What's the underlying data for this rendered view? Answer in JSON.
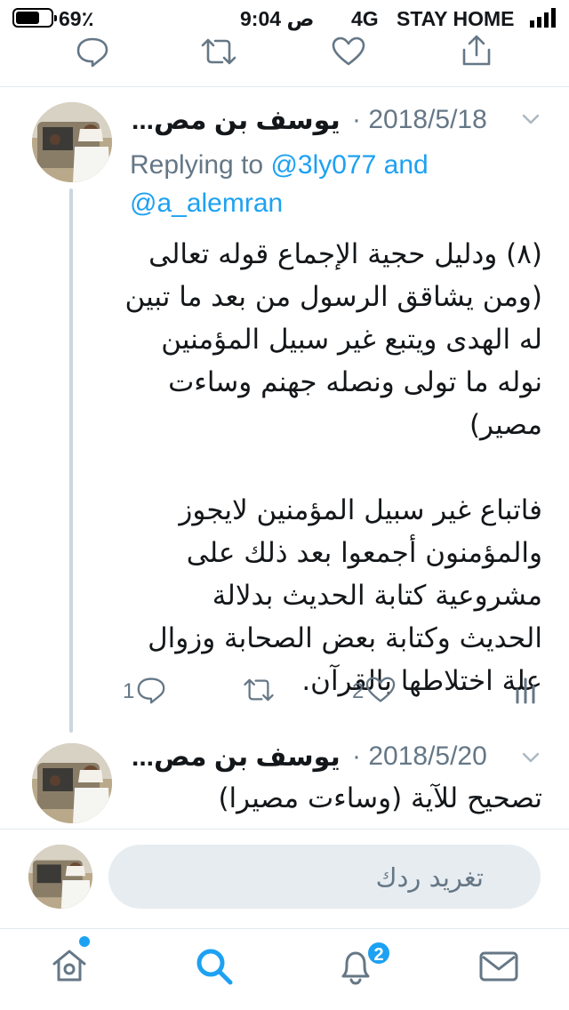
{
  "status_bar": {
    "battery": "69٪",
    "time": "9:04 ص",
    "network": "4G",
    "carrier": "STAY HOME"
  },
  "tweets": [
    {
      "name": "يوسف بن مص...",
      "date": "2018/5/18",
      "reply_prefix": "Replying to",
      "reply_handle_1": "@3ly077",
      "reply_and": "and",
      "reply_handle_2": "@a_alemran",
      "body": "(٨) ودليل حجية الإجماع قوله تعالى (ومن يشاقق الرسول من بعد ما تبين له الهدى ويتبع غير سبيل المؤمنين نوله ما تولى ونصله جهنم وساءت مصير)\n\nفاتباع غير سبيل المؤمنين لايجوز والمؤمنون أجمعوا بعد ذلك على مشروعية كتابة الحديث بدلالة الحديث وكتابة بعض الصحابة وزوال علة اختلاطها بالقرآن.",
      "reply_count": "1",
      "like_count": "2"
    },
    {
      "name": "يوسف بن مص...",
      "date": "2018/5/20",
      "body": "تصحيح للآية (وساءت مصيرا)"
    }
  ],
  "compose": {
    "placeholder": "تغريد ردك"
  },
  "tabbar": {
    "notifications_badge": "2"
  },
  "colors": {
    "accent": "#1da1f2",
    "secondary_text": "#657786",
    "divider": "#e1e8ed"
  },
  "icons": [
    "reply-icon",
    "retweet-icon",
    "like-icon",
    "share-icon",
    "analytics-icon",
    "chevron-down-icon",
    "home-icon",
    "search-icon",
    "notifications-icon",
    "messages-icon"
  ]
}
